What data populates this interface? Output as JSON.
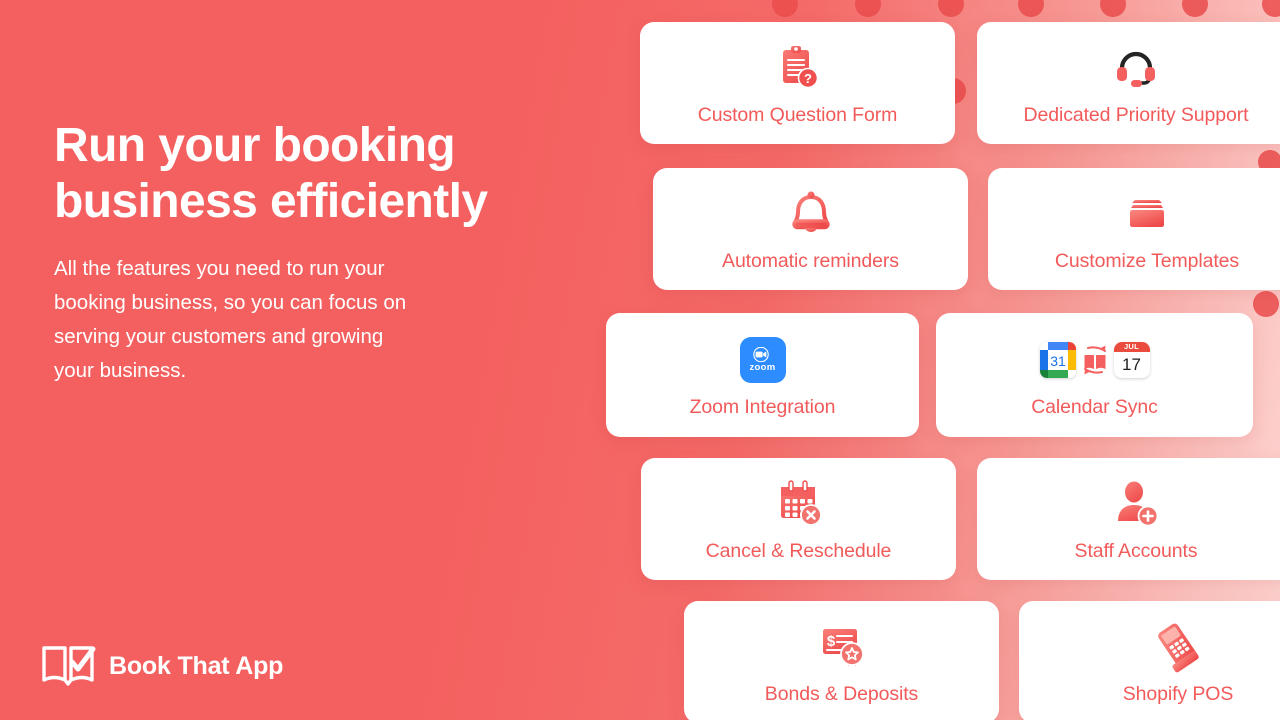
{
  "theme": {
    "bg_left": "#f4605f",
    "bg_right": "#fdd6d3",
    "dot_color": "#ea4c4c",
    "card_bg": "#ffffff",
    "card_label_color": "#f25a5a",
    "heading_color": "#ffffff",
    "zoom_blue": "#2d8cff",
    "apple_cal_red": "#eb4b3c"
  },
  "hero": {
    "headline": "Run your booking\nbusiness efficiently",
    "subcopy": "All the features you need to run your\nbooking business, so you can focus on\nserving your customers and growing\nyour business."
  },
  "brand": {
    "name": "Book That App",
    "logo_icon": "open-book-check-icon"
  },
  "features": [
    {
      "id": "custom-question-form",
      "label": "Custom Question Form",
      "icon": "clipboard-question-icon"
    },
    {
      "id": "dedicated-priority-support",
      "label": "Dedicated Priority Support",
      "icon": "headset-icon"
    },
    {
      "id": "automatic-reminders",
      "label": "Automatic reminders",
      "icon": "bell-icon"
    },
    {
      "id": "customize-templates",
      "label": "Customize Templates",
      "icon": "template-stack-icon"
    },
    {
      "id": "zoom-integration",
      "label": "Zoom Integration",
      "icon": "zoom-app-icon",
      "badge_text": "zoom"
    },
    {
      "id": "calendar-sync",
      "label": "Calendar Sync",
      "icon": "calendar-sync-icon",
      "google_day": "31",
      "apple_month": "JUL",
      "apple_day": "17"
    },
    {
      "id": "cancel-reschedule",
      "label": "Cancel & Reschedule",
      "icon": "calendar-cancel-icon"
    },
    {
      "id": "staff-accounts",
      "label": "Staff Accounts",
      "icon": "user-add-icon"
    },
    {
      "id": "bonds-deposits",
      "label": "Bonds & Deposits",
      "icon": "certificate-dollar-icon"
    },
    {
      "id": "shopify-pos",
      "label": "Shopify POS",
      "icon": "card-terminal-icon"
    }
  ]
}
